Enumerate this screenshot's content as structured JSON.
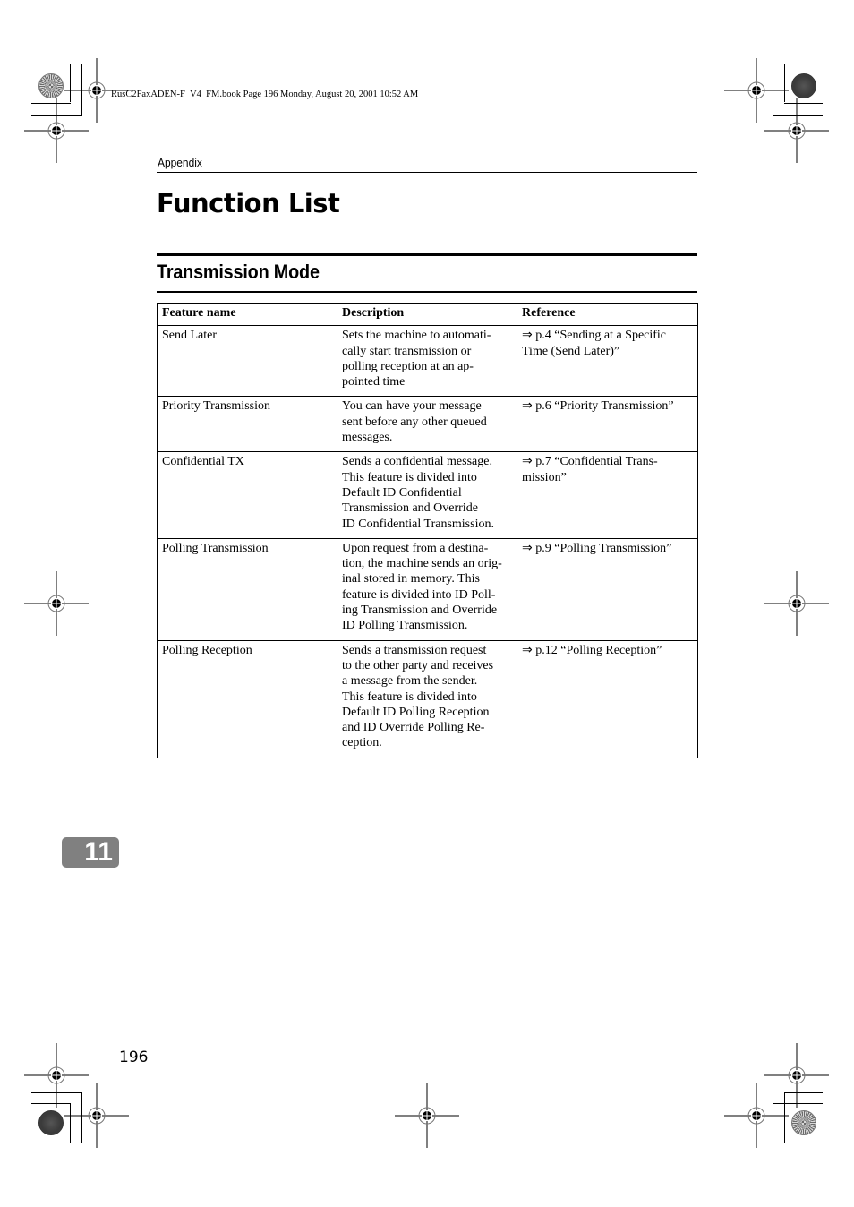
{
  "print_meta": {
    "text": "RusC2FaxADEN-F_V4_FM.book  Page 196  Monday, August 20, 2001  10:52 AM"
  },
  "running_head": "Appendix",
  "page_title": "Function List",
  "section_title": "Transmission Mode",
  "table": {
    "headers": [
      "Feature name",
      "Description",
      "Reference"
    ],
    "rows": [
      {
        "feature": "Send Later",
        "description": "Sets the machine to automati-\ncally start transmission or\npolling reception at an ap-\npointed time",
        "reference": "⇒ p.4 “Sending at a Specific\nTime (Send Later)”"
      },
      {
        "feature": "Priority Transmission",
        "description": "You can have your message\nsent before any other queued\nmessages.",
        "reference": "⇒ p.6 “Priority Transmission”"
      },
      {
        "feature": "Confidential TX",
        "description": "Sends a confidential message.\nThis feature is divided into\nDefault ID Confidential\nTransmission and Override\nID Confidential Transmission.",
        "reference": "⇒ p.7 “Confidential Trans-\nmission”"
      },
      {
        "feature": "Polling Transmission",
        "description": "Upon request from a destina-\ntion, the machine sends an orig-\ninal stored in memory. This\nfeature is divided into ID Poll-\ning Transmission and Override\nID Polling Transmission.",
        "reference": "⇒ p.9 “Polling Transmission”"
      },
      {
        "feature": "Polling Reception",
        "description": "Sends a transmission request\nto the other party and receives\na message from the sender.\nThis feature is divided into\nDefault ID Polling Reception\nand ID Override Polling Re-\nception.",
        "reference": "⇒ p.12 “Polling Reception”"
      }
    ]
  },
  "chapter_tab": "11",
  "page_number": "196",
  "icons": {
    "registration_mark": "crosshair-target",
    "color_bar": "starburst-circle"
  },
  "colors": {
    "chapter_tab_bg": "#808080",
    "text": "#000000"
  }
}
